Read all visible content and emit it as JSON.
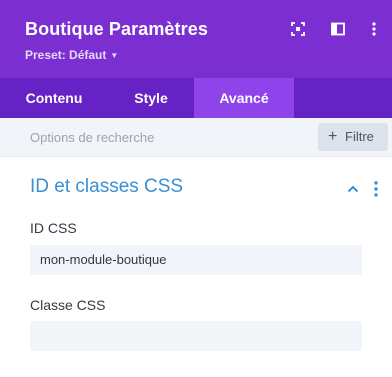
{
  "header": {
    "title": "Boutique Paramètres",
    "preset_label": "Preset: Défaut",
    "icons": [
      "focus-icon",
      "sidebar-toggle-icon",
      "more-vertical-icon"
    ],
    "background": "#7b2fd1"
  },
  "tabs": [
    {
      "label": "Contenu",
      "active": false
    },
    {
      "label": "Style",
      "active": false
    },
    {
      "label": "Avancé",
      "active": true
    }
  ],
  "filterbar": {
    "search_placeholder": "Options de recherche",
    "filter_label": "Filtre"
  },
  "section": {
    "title": "ID et classes CSS",
    "accent": "#3b8fd4"
  },
  "fields": {
    "css_id": {
      "label": "ID CSS",
      "value": "mon-module-boutique"
    },
    "css_class": {
      "label": "Classe CSS",
      "value": ""
    }
  }
}
